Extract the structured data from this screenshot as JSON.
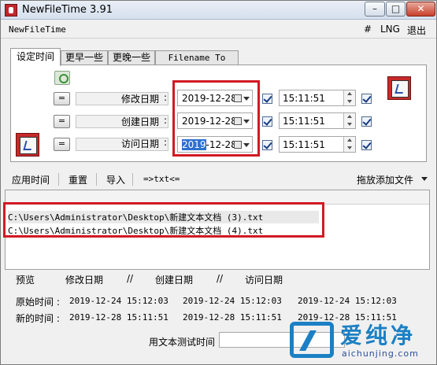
{
  "window": {
    "title": "NewFileTime 3.91",
    "min_glyph": "–",
    "max_glyph": "□",
    "close_glyph": "✕"
  },
  "menubar": {
    "app_name": "NewFileTime",
    "hash": "#",
    "lng": "LNG",
    "exit": "退出"
  },
  "tabs": [
    {
      "label": "设定时间"
    },
    {
      "label": "更早一些"
    },
    {
      "label": "更晚一些"
    },
    {
      "label": "Filename To Time"
    }
  ],
  "rows": [
    {
      "eq": "=",
      "label": "修改日期",
      "colon": ":",
      "date": "2019-12-28",
      "time": "15:11:51"
    },
    {
      "eq": "=",
      "label": "创建日期",
      "colon": ":",
      "date": "2019-12-28",
      "time": "15:11:51"
    },
    {
      "eq": "=",
      "label": "访问日期",
      "colon": ":",
      "date_sel": "2019",
      "date_rest": "-12-28",
      "time": "15:11:51"
    }
  ],
  "toolbar": {
    "apply": "应用时间",
    "reset": "重置",
    "import": "导入",
    "txt": "=>txt<=",
    "drag_add": "拖放添加文件"
  },
  "files": [
    "C:\\Users\\Administrator\\Desktop\\新建文本文档 (3).txt",
    "C:\\Users\\Administrator\\Desktop\\新建文本文档 (4).txt"
  ],
  "compare": {
    "header": {
      "preview": "预览",
      "sep": "//",
      "modified": "修改日期",
      "created": "创建日期",
      "accessed": "访问日期"
    },
    "original": {
      "label": "原始时间 :",
      "modified": "2019-12-24 15:12:03",
      "created": "2019-12-24 15:12:03",
      "accessed": "2019-12-24 15:12:03"
    },
    "new": {
      "label": "新的时间 :",
      "modified": "2019-12-28 15:11:51",
      "created": "2019-12-28 15:11:51",
      "accessed": "2019-12-28 15:11:51"
    }
  },
  "bottom": {
    "test_label": "用文本测试时间"
  },
  "watermark": {
    "text": "爱纯净",
    "url": "aichunjing.com"
  },
  "colors": {
    "highlight_red": "#d11a24",
    "selection_blue": "#2f6fd1",
    "watermark_blue": "#1b80c4"
  }
}
